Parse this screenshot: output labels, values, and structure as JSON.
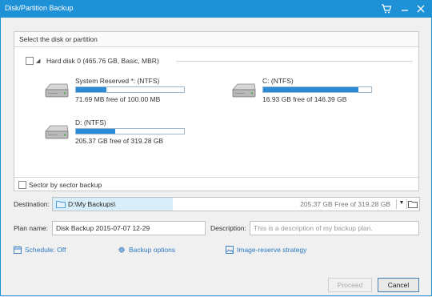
{
  "window": {
    "title": "Disk/Partition Backup"
  },
  "panel": {
    "header": "Select the disk or partition",
    "disk": {
      "label": "Hard disk 0 (465.76 GB, Basic, MBR)"
    },
    "partitions": [
      {
        "name": "System Reserved *: (NTFS)",
        "free": "71.69 MB free of 100.00 MB",
        "used_fraction": 0.28
      },
      {
        "name": "C: (NTFS)",
        "free": "16.93 GB free of 146.39 GB",
        "used_fraction": 0.88
      },
      {
        "name": "D: (NTFS)",
        "free": "205.37 GB free of 319.28 GB",
        "used_fraction": 0.36
      }
    ],
    "sector_backup_label": "Sector by sector backup"
  },
  "destination": {
    "label": "Destination:",
    "path": "D:\\My Backups\\",
    "free": "205.37 GB Free of 319.28 GB"
  },
  "plan": {
    "label": "Plan name:",
    "value": "Disk Backup 2015-07-07 12-29"
  },
  "description": {
    "label": "Description:",
    "placeholder": "This is a description of my backup plan."
  },
  "links": {
    "schedule": "Schedule: Off",
    "backup_options": "Backup options",
    "image_reserve": "Image-reserve strategy"
  },
  "buttons": {
    "proceed": "Proceed",
    "cancel": "Cancel"
  },
  "colors": {
    "accent": "#1e90d6",
    "link": "#2c79c3",
    "bar_fill": "#2b8ad8"
  }
}
